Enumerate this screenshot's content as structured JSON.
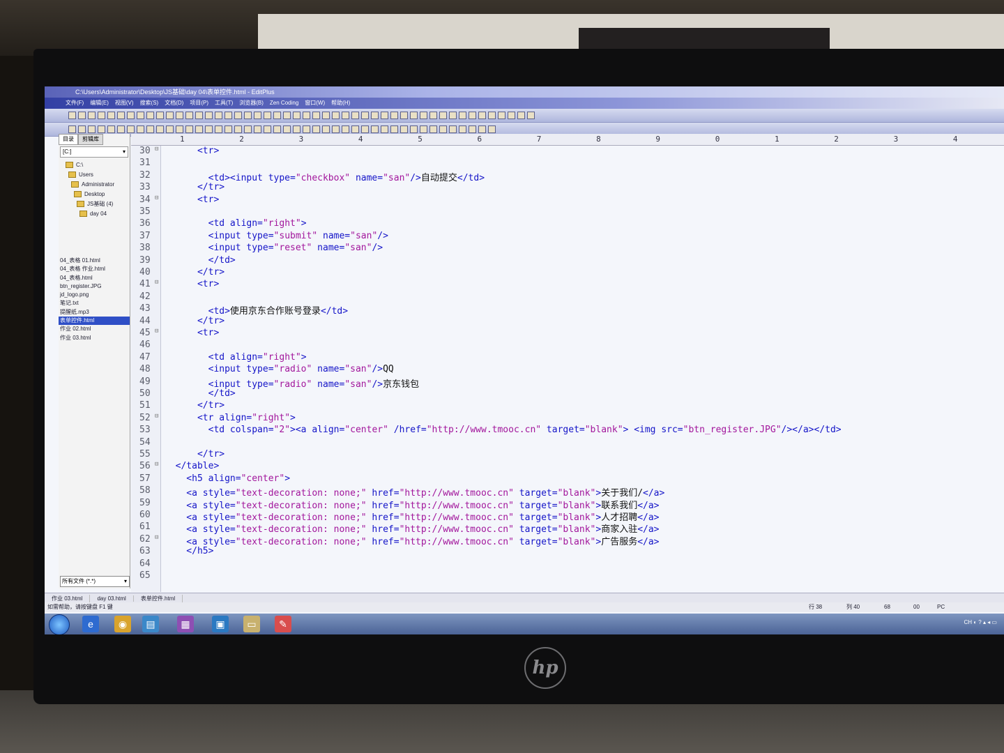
{
  "window": {
    "title": "C:\\Users\\Administrator\\Desktop\\JS基础\\day 04\\表单控件.html - EditPlus"
  },
  "menu": [
    "文件(F)",
    "编辑(E)",
    "视图(V)",
    "搜索(S)",
    "文档(D)",
    "项目(P)",
    "工具(T)",
    "浏览器(B)",
    "Zen Coding",
    "窗口(W)",
    "帮助(H)"
  ],
  "sidebar": {
    "tabs": [
      "目录",
      "剪辑库"
    ],
    "drive": "[C:]",
    "tree": [
      "C:\\",
      "Users",
      "Administrator",
      "Desktop",
      "JS基础 (4)",
      "day 04"
    ],
    "files": [
      "04_表格 01.html",
      "04_表格 作业.html",
      "04_表格.html",
      "btn_register.JPG",
      "jd_logo.png",
      "笔记.txt",
      "提醒纸.mp3",
      "表单控件.html",
      "作业 02.html",
      "作业 03.html"
    ],
    "selected_file": "表单控件.html",
    "filter": "所有文件 (*.*)"
  },
  "ruler": [
    "1",
    "2",
    "3",
    "4",
    "5",
    "6",
    "7",
    "8",
    "9",
    "0",
    "1",
    "2",
    "3",
    "4"
  ],
  "code_lines": [
    {
      "n": "30",
      "text": "      <tr>"
    },
    {
      "n": "31",
      "text": ""
    },
    {
      "n": "32",
      "text": "        <td><input type=\"checkbox\" name=\"san\"/>自动提交</td>"
    },
    {
      "n": "33",
      "text": "      </tr>"
    },
    {
      "n": "34",
      "text": "      <tr>"
    },
    {
      "n": "35",
      "text": ""
    },
    {
      "n": "36",
      "text": "        <td align=\"right\">"
    },
    {
      "n": "37",
      "text": "        <input type=\"submit\" name=\"san\"/>"
    },
    {
      "n": "38",
      "text": "        <input type=\"reset\" name=\"san\"/>"
    },
    {
      "n": "39",
      "text": "        </td>"
    },
    {
      "n": "40",
      "text": "      </tr>"
    },
    {
      "n": "41",
      "text": "      <tr>"
    },
    {
      "n": "42",
      "text": ""
    },
    {
      "n": "43",
      "text": "        <td>使用京东合作账号登录</td>"
    },
    {
      "n": "44",
      "text": "      </tr>"
    },
    {
      "n": "45",
      "text": "      <tr>"
    },
    {
      "n": "46",
      "text": ""
    },
    {
      "n": "47",
      "text": "        <td align=\"right\">"
    },
    {
      "n": "48",
      "text": "        <input type=\"radio\" name=\"san\"/>QQ"
    },
    {
      "n": "49",
      "text": "        <input type=\"radio\" name=\"san\"/>京东钱包"
    },
    {
      "n": "50",
      "text": "        </td>"
    },
    {
      "n": "51",
      "text": "      </tr>"
    },
    {
      "n": "52",
      "text": "      <tr align=\"right\">"
    },
    {
      "n": "53",
      "text": "        <td colspan=\"2\"><a align=\"center\" /href=\"http://www.tmooc.cn\" target=\"blank\"> <img src=\"btn_register.JPG\"/></a></td>"
    },
    {
      "n": "54",
      "text": ""
    },
    {
      "n": "55",
      "text": "      </tr>"
    },
    {
      "n": "56",
      "text": "  </table>"
    },
    {
      "n": "57",
      "text": "    <h5 align=\"center\">"
    },
    {
      "n": "58",
      "text": "    <a style=\"text-decoration: none;\" href=\"http://www.tmooc.cn\" target=\"blank\">关于我们/</a>"
    },
    {
      "n": "59",
      "text": "    <a style=\"text-decoration: none;\" href=\"http://www.tmooc.cn\" target=\"blank\">联系我们</a>"
    },
    {
      "n": "60",
      "text": "    <a style=\"text-decoration: none;\" href=\"http://www.tmooc.cn\" target=\"blank\">人才招聘</a>"
    },
    {
      "n": "61",
      "text": "    <a style=\"text-decoration: none;\" href=\"http://www.tmooc.cn\" target=\"blank\">商家入驻</a>"
    },
    {
      "n": "62",
      "text": "    <a style=\"text-decoration: none;\" href=\"http://www.tmooc.cn\" target=\"blank\">广告服务</a>"
    },
    {
      "n": "63",
      "text": "    </h5>"
    },
    {
      "n": "64",
      "text": ""
    },
    {
      "n": "65",
      "text": ""
    }
  ],
  "fold_lines": [
    "30",
    "34",
    "41",
    "45",
    "52",
    "56",
    "62"
  ],
  "file_tabs": [
    "作业 03.html",
    "day 03.html",
    "表单控件.html"
  ],
  "status": {
    "help": "如需帮助，请按键盘 F1 键",
    "line": "行 38",
    "col": "列 40",
    "size": "68",
    "misc": "00",
    "mode": "PC"
  },
  "colors": {
    "tag": "#1414c8",
    "string": "#a2169c",
    "text": "#111111",
    "titlebar": "#5a63b8"
  },
  "monitor": {
    "brand_logo": "hp"
  }
}
